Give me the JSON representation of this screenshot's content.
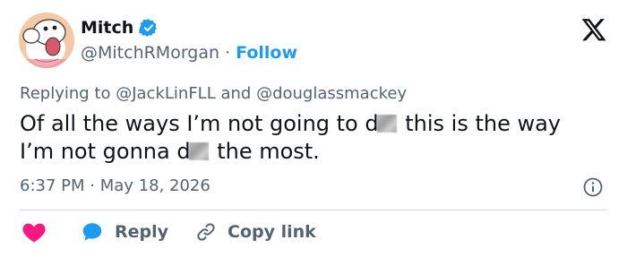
{
  "author": {
    "name": "Mitch",
    "handle": "@MitchRMorgan",
    "separator": "·",
    "follow_label": "Follow"
  },
  "replying": {
    "prefix": "Replying to",
    "mention1": "@JackLinFLL",
    "and": "and",
    "mention2": "@douglassmackey"
  },
  "tweet": {
    "line1_a": "Of all the ways I’m not going to d",
    "line1_b": " this is the way",
    "line2_a": "I’m not gonna d",
    "line2_b": " the most."
  },
  "meta": {
    "time": "6:37 PM",
    "separator": "·",
    "date": "May 18, 2026"
  },
  "actions": {
    "reply_label": "Reply",
    "copy_link_label": "Copy link"
  },
  "colors": {
    "accent": "#1d9bf0",
    "like": "#f91880",
    "muted": "#536471",
    "text": "#0f1419"
  },
  "icons": {
    "verified": "verified-badge-icon",
    "x_logo": "x-logo-icon",
    "info": "info-icon",
    "like": "heart-icon",
    "reply": "speech-bubble-icon",
    "copy_link": "link-icon"
  }
}
